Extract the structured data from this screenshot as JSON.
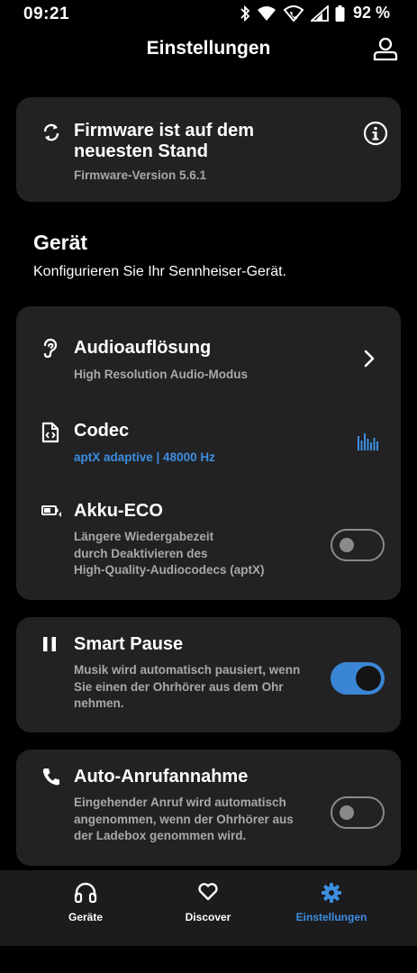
{
  "status": {
    "time": "09:21",
    "battery": "92 %"
  },
  "header": {
    "title": "Einstellungen",
    "profile_icon": "person-icon"
  },
  "firmware": {
    "title": "Firmware ist auf dem neuesten Stand",
    "version": "Firmware-Version 5.6.1",
    "icon": "sync-icon",
    "info_icon": "info-icon"
  },
  "section": {
    "title": "Gerät",
    "subtitle": "Konfigurieren Sie Ihr Sennheiser-Gerät."
  },
  "device": {
    "audio": {
      "title": "Audioauflösung",
      "subtitle": "High Resolution Audio-Modus",
      "icon": "ear-icon"
    },
    "codec": {
      "title": "Codec",
      "subtitle": "aptX adaptive | 48000 Hz",
      "icon": "code-file-icon",
      "accent": "#3d8ee0"
    },
    "eco": {
      "title": "Akku-ECO",
      "subtitle_line1": "Längere Wiedergabezeit",
      "subtitle_line2": "durch Deaktivieren des",
      "subtitle_line3": "High-Quality-Audiocodecs (aptX)",
      "icon": "battery-eco-icon",
      "enabled": false
    }
  },
  "smart_pause": {
    "title": "Smart Pause",
    "subtitle_line1": "Musik wird automatisch pausiert, wenn",
    "subtitle_line2": "Sie einen der Ohrhörer aus dem Ohr",
    "subtitle_line3": "nehmen.",
    "icon": "pause-icon",
    "enabled": true
  },
  "auto_answer": {
    "title": "Auto-Anrufannahme",
    "subtitle_line1": "Eingehender Anruf wird automatisch",
    "subtitle_line2": "angenommen, wenn der Ohrhörer aus",
    "subtitle_line3": "der Ladebox genommen wird.",
    "icon": "phone-icon",
    "enabled": false
  },
  "nav": {
    "devices": "Geräte",
    "discover": "Discover",
    "settings": "Einstellungen",
    "active": "settings"
  },
  "colors": {
    "background": "#000000",
    "card": "#222224",
    "accent": "#3a86d4",
    "secondary_text": "#a8a8a8"
  }
}
